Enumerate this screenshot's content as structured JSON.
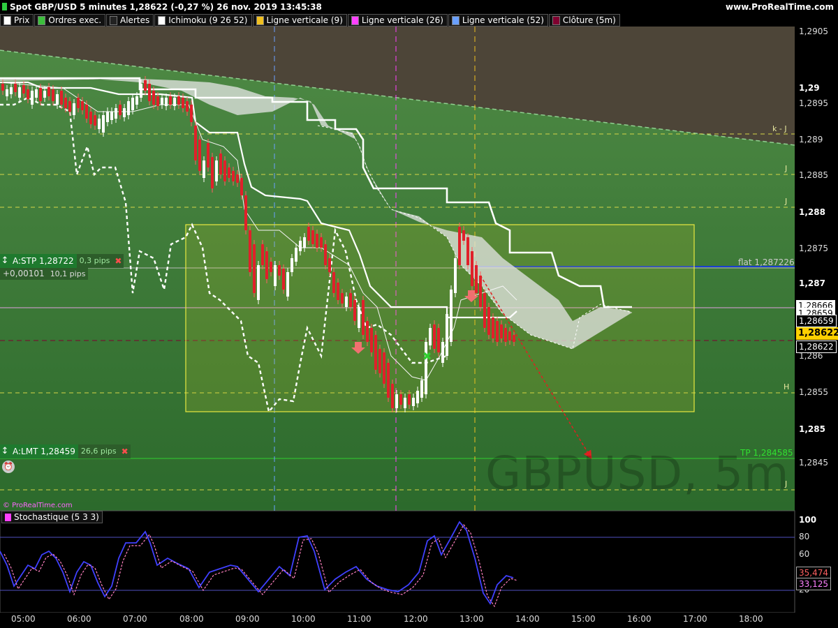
{
  "title": "Spot GBP/USD 5 minutes 1,28622 (-0,27 %) 26 nov. 2019 13:45:38",
  "site": "www.ProRealTime.com",
  "legend": [
    {
      "label": "Prix",
      "color": "#ffffff"
    },
    {
      "label": "Ordres exec.",
      "color": "#3cbf3c"
    },
    {
      "label": "Alertes",
      "color": "#222222"
    },
    {
      "label": "Ichimoku (9 26 52)",
      "color": "#ffffff"
    },
    {
      "label": "Ligne verticale (9)",
      "color": "#f0c020"
    },
    {
      "label": "Ligne verticale (26)",
      "color": "#ff40ff"
    },
    {
      "label": "Ligne verticale (52)",
      "color": "#6aa0ff"
    },
    {
      "label": "Clôture (5m)",
      "color": "#800030"
    }
  ],
  "price_axis": [
    "1,2905",
    "1,29",
    "1,2895",
    "1,289",
    "1,2885",
    "1,288",
    "1,2875",
    "1,287",
    "1,2865",
    "1,286",
    "1,2855",
    "1,285",
    "1,2845"
  ],
  "price_tags": {
    "p1": "1,28666",
    "p2": "1,28659",
    "p3": "1,28659",
    "current": "1,28622",
    "p4": "1,28622"
  },
  "line_labels": {
    "kj": "k - J",
    "j1": "J",
    "j2": "J",
    "h": "H",
    "j3": "J",
    "flat": "flat 1,287226",
    "tp": "TP 1,284585"
  },
  "orders": {
    "stp": {
      "label": "A:STP  1,28722",
      "pips": "0,3 pips",
      "close": "✖"
    },
    "stp_sub": {
      "pnl": "+0,00101",
      "pips": "10,1 pips"
    },
    "lmt": {
      "label": "A:LMT  1,28459",
      "pips": "26,6 pips",
      "close": "✖"
    }
  },
  "watermark": "GBPUSD, 5m",
  "prt_mark": "© ProRealTime.com",
  "stochastic": {
    "legend": "Stochastique (5 3 3)",
    "axis": [
      "100",
      "80",
      "60",
      "40",
      "20"
    ],
    "k_value": "35,474",
    "d_value": "33,125"
  },
  "time_axis": [
    "05:00",
    "06:00",
    "07:00",
    "08:00",
    "09:00",
    "10:00",
    "11:00",
    "12:00",
    "13:00",
    "14:00",
    "15:00",
    "16:00",
    "17:00",
    "18:00"
  ],
  "colors": {
    "green_bg": "#3e7a3a",
    "bear": "#e0202a",
    "bull": "#ffffff",
    "box": "#e8e840",
    "flat_line": "#1a3fd0"
  }
}
